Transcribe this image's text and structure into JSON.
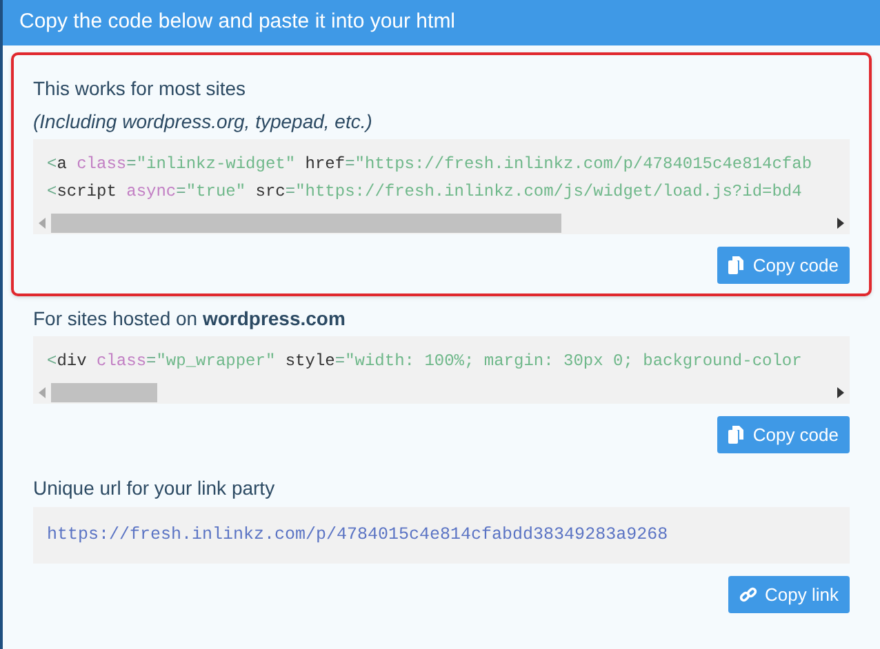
{
  "header": {
    "title": "Copy the code below and paste it into your html"
  },
  "sections": [
    {
      "kind": "code",
      "highlighted": true,
      "title": "This works for most sites",
      "subtitle": "(Including wordpress.org, typepad, etc.)",
      "lines": [
        [
          {
            "kind": "punct",
            "text": "<"
          },
          {
            "kind": "plain",
            "text": "a "
          },
          {
            "kind": "attr",
            "text": "class"
          },
          {
            "kind": "punct",
            "text": "="
          },
          {
            "kind": "value",
            "text": "\"inlinkz-widget\""
          },
          {
            "kind": "plain",
            "text": " href"
          },
          {
            "kind": "punct",
            "text": "="
          },
          {
            "kind": "value",
            "text": "\"https://fresh.inlinkz.com/p/4784015c4e814cfab"
          }
        ],
        [
          {
            "kind": "punct",
            "text": "<"
          },
          {
            "kind": "plain",
            "text": "script "
          },
          {
            "kind": "attr",
            "text": "async"
          },
          {
            "kind": "punct",
            "text": "="
          },
          {
            "kind": "value",
            "text": "\"true\""
          },
          {
            "kind": "plain",
            "text": " src"
          },
          {
            "kind": "punct",
            "text": "="
          },
          {
            "kind": "value",
            "text": "\"https://fresh.inlinkz.com/js/widget/load.js?id=bd4"
          }
        ]
      ],
      "button": {
        "label": "Copy code"
      }
    },
    {
      "kind": "code",
      "title": "For sites hosted on **wordpress.com**",
      "lines": [
        [
          {
            "kind": "punct",
            "text": "<"
          },
          {
            "kind": "plain",
            "text": "div "
          },
          {
            "kind": "attr",
            "text": "class"
          },
          {
            "kind": "punct",
            "text": "="
          },
          {
            "kind": "value",
            "text": "\"wp_wrapper\""
          },
          {
            "kind": "plain",
            "text": " style"
          },
          {
            "kind": "punct",
            "text": "="
          },
          {
            "kind": "value",
            "text": "\"width: 100%; margin: 30px 0; background-color"
          }
        ]
      ],
      "button": {
        "label": "Copy code"
      }
    },
    {
      "kind": "url",
      "title": "Unique url for your link party",
      "url": "https://fresh.inlinkz.com/p/4784015c4e814cfabdd38349283a9268",
      "button": {
        "label": "Copy link"
      }
    }
  ]
}
